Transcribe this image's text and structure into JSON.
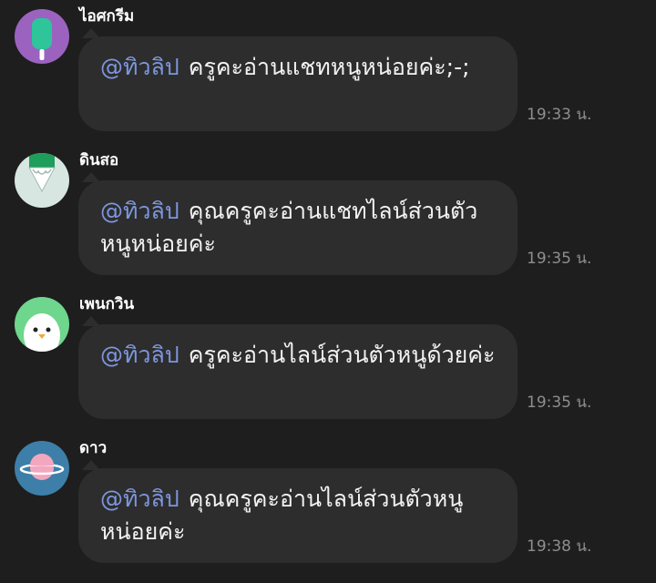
{
  "messages": [
    {
      "sender": "ไอศกรีม",
      "avatar_icon": "popsicle-icon",
      "mention": "@ทิวลิป",
      "text": "ครูคะอ่านแชทหนูหน่อยค่ะ;-;",
      "time": "19:33 น."
    },
    {
      "sender": "ดินสอ",
      "avatar_icon": "pencil-icon",
      "mention": "@ทิวลิป",
      "text": "คุณครูคะอ่านแชทไลน์ส่วนตัวหนูหน่อยค่ะ",
      "time": "19:35 น."
    },
    {
      "sender": "เพนกวิน",
      "avatar_icon": "penguin-icon",
      "mention": "@ทิวลิป",
      "text": "ครูคะอ่านไลน์ส่วนตัวหนูด้วยค่ะ",
      "time": "19:35 น."
    },
    {
      "sender": "ดาว",
      "avatar_icon": "planet-icon",
      "mention": "@ทิวลิป",
      "text": "คุณครูคะอ่านไลน์ส่วนตัวหนูหน่อยค่ะ",
      "time": "19:38 น."
    }
  ],
  "colors": {
    "background": "#1e1e1e",
    "bubble": "#2d2d2d",
    "mention": "#7d96de",
    "time": "#8e8e8e"
  }
}
